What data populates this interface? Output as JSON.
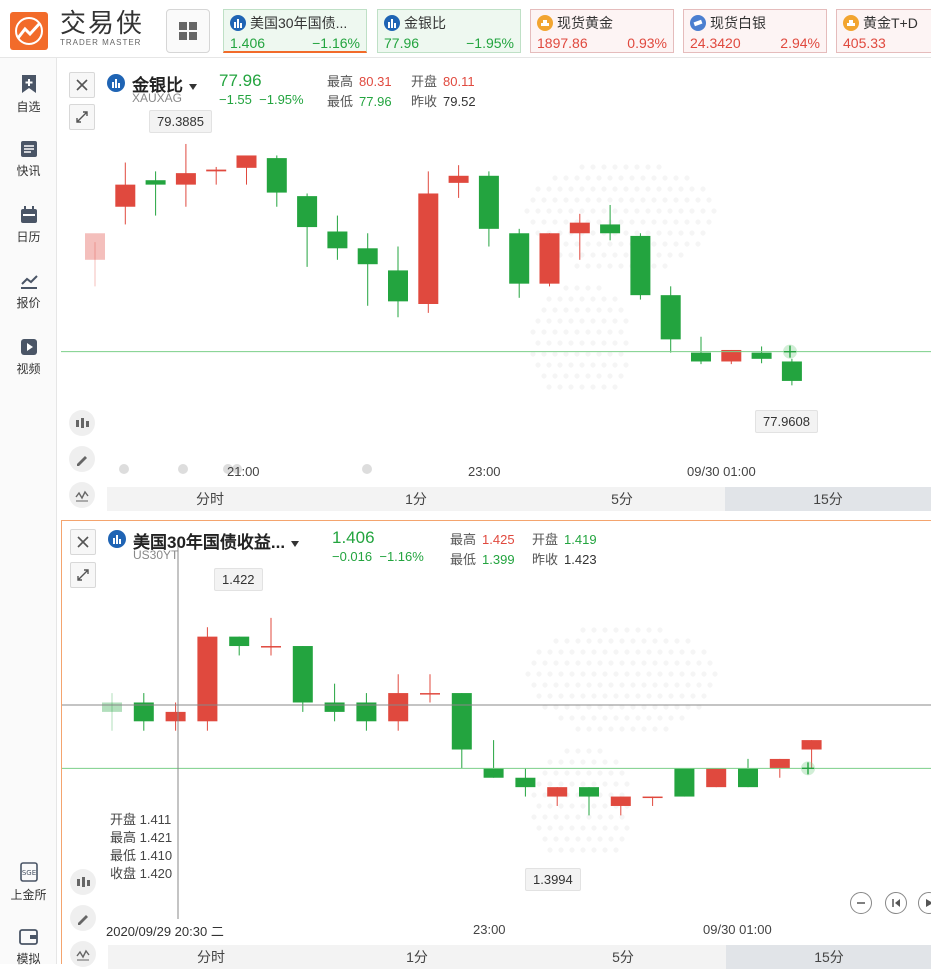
{
  "brand": {
    "name_cn": "交易侠",
    "name_en": "TRADER MASTER",
    "color": "#f26b2a"
  },
  "tickers": [
    {
      "name": "美国30年国债...",
      "price": "1.406",
      "change": "−1.16%",
      "trend": "green",
      "icon": "chart-icon"
    },
    {
      "name": "金银比",
      "price": "77.96",
      "change": "−1.95%",
      "trend": "green",
      "icon": "chart-icon"
    },
    {
      "name": "现货黄金",
      "price": "1897.86",
      "change": "0.93%",
      "trend": "red",
      "icon": "gold-bars-icon"
    },
    {
      "name": "现货白银",
      "price": "24.3420",
      "change": "2.94%",
      "trend": "red",
      "icon": "silver-icon"
    },
    {
      "name": "黄金T+D",
      "price": "405.33",
      "change": "",
      "trend": "red",
      "icon": "gold-bars-icon"
    }
  ],
  "sidebar": {
    "items": [
      {
        "label": "自选",
        "icon": "bookmark-plus-icon"
      },
      {
        "label": "快讯",
        "icon": "news-icon"
      },
      {
        "label": "日历",
        "icon": "calendar-icon"
      },
      {
        "label": "报价",
        "icon": "quote-chart-icon"
      },
      {
        "label": "视频",
        "icon": "video-icon"
      }
    ],
    "bottom": [
      {
        "label": "上金所",
        "icon": "sge-icon"
      },
      {
        "label": "模拟",
        "icon": "wallet-icon"
      }
    ]
  },
  "panel1": {
    "name": "金银比",
    "code": "XAUXAG",
    "price": "77.96",
    "change": "−1.55",
    "change_pct": "−1.95%",
    "stats": {
      "high_k": "最高",
      "high": "80.31",
      "open_k": "开盘",
      "open": "80.11",
      "low_k": "最低",
      "low": "77.96",
      "prev_k": "昨收",
      "prev": "79.52"
    },
    "tip_high": "79.3885",
    "tip_last": "77.9608",
    "times": [
      "21:00",
      "23:00",
      "09/30 01:00"
    ],
    "tabs": [
      "分时",
      "1分",
      "5分",
      "15分"
    ],
    "active_tab": 3
  },
  "panel2": {
    "name": "美国30年国债收益...",
    "code": "US30YT",
    "price": "1.406",
    "change": "−0.016",
    "change_pct": "−1.16%",
    "stats": {
      "high_k": "最高",
      "high": "1.425",
      "open_k": "开盘",
      "open": "1.419",
      "low_k": "最低",
      "low": "1.399",
      "prev_k": "昨收",
      "prev": "1.423"
    },
    "tip_high": "1.422",
    "tip_low": "1.3994",
    "ohlc": {
      "open": "开盘 1.411",
      "high": "最高 1.421",
      "low": "最低 1.410",
      "close": "收盘 1.420"
    },
    "cursor_time": "2020/09/29 20:30 二",
    "times": [
      "23:00",
      "09/30 01:00"
    ],
    "tabs": [
      "分时",
      "1分",
      "5分",
      "15分"
    ],
    "active_tab": 3
  },
  "colors": {
    "up": "#e0493e",
    "down": "#23a43f",
    "accent": "#f26b2a",
    "blue": "#1f64b4"
  },
  "chart_data": [
    {
      "type": "candlestick",
      "series_code": "XAUXAG",
      "x_ticks": [
        "21:00",
        "23:00",
        "09/30 01:00"
      ],
      "candles": [
        {
          "o": 79.0,
          "h": 79.2,
          "l": 78.7,
          "c": 79.3
        },
        {
          "o": 79.6,
          "h": 80.1,
          "l": 79.4,
          "c": 79.85
        },
        {
          "o": 79.9,
          "h": 80.0,
          "l": 79.5,
          "c": 79.85
        },
        {
          "o": 79.85,
          "h": 80.31,
          "l": 79.6,
          "c": 79.98
        },
        {
          "o": 80.0,
          "h": 80.05,
          "l": 79.85,
          "c": 80.02
        },
        {
          "o": 80.04,
          "h": 80.16,
          "l": 79.85,
          "c": 80.18
        },
        {
          "o": 80.15,
          "h": 80.18,
          "l": 79.6,
          "c": 79.76
        },
        {
          "o": 79.72,
          "h": 79.75,
          "l": 78.92,
          "c": 79.37
        },
        {
          "o": 79.32,
          "h": 79.5,
          "l": 79.0,
          "c": 79.13
        },
        {
          "o": 79.13,
          "h": 79.3,
          "l": 78.48,
          "c": 78.95
        },
        {
          "o": 78.88,
          "h": 79.15,
          "l": 78.35,
          "c": 78.53
        },
        {
          "o": 78.5,
          "h": 80.0,
          "l": 78.4,
          "c": 79.75
        },
        {
          "o": 79.87,
          "h": 80.07,
          "l": 79.7,
          "c": 79.95
        },
        {
          "o": 79.95,
          "h": 80.0,
          "l": 79.15,
          "c": 79.35
        },
        {
          "o": 79.3,
          "h": 79.35,
          "l": 78.57,
          "c": 78.73
        },
        {
          "o": 78.73,
          "h": 79.3,
          "l": 78.7,
          "c": 79.3
        },
        {
          "o": 79.3,
          "h": 79.52,
          "l": 79.0,
          "c": 79.42
        },
        {
          "o": 79.4,
          "h": 79.62,
          "l": 79.22,
          "c": 79.3
        },
        {
          "o": 79.27,
          "h": 79.3,
          "l": 78.55,
          "c": 78.6
        },
        {
          "o": 78.6,
          "h": 78.7,
          "l": 77.95,
          "c": 78.1
        },
        {
          "o": 77.95,
          "h": 78.13,
          "l": 77.82,
          "c": 77.85
        },
        {
          "o": 77.85,
          "h": 77.98,
          "l": 77.82,
          "c": 77.98
        },
        {
          "o": 77.95,
          "h": 78.02,
          "l": 77.83,
          "c": 77.88
        },
        {
          "o": 77.85,
          "h": 77.88,
          "l": 77.58,
          "c": 77.63
        }
      ],
      "last_price": 77.9608,
      "ylim": [
        77.55,
        80.4
      ]
    },
    {
      "type": "candlestick",
      "series_code": "US30YT",
      "x_ticks": [
        "23:00",
        "09/30 01:00"
      ],
      "candles": [
        {
          "o": 1.413,
          "h": 1.414,
          "l": 1.41,
          "c": 1.412
        },
        {
          "o": 1.413,
          "h": 1.414,
          "l": 1.41,
          "c": 1.411
        },
        {
          "o": 1.411,
          "h": 1.413,
          "l": 1.41,
          "c": 1.412
        },
        {
          "o": 1.411,
          "h": 1.421,
          "l": 1.41,
          "c": 1.42
        },
        {
          "o": 1.42,
          "h": 1.42,
          "l": 1.418,
          "c": 1.419
        },
        {
          "o": 1.419,
          "h": 1.422,
          "l": 1.418,
          "c": 1.419
        },
        {
          "o": 1.419,
          "h": 1.419,
          "l": 1.412,
          "c": 1.413
        },
        {
          "o": 1.413,
          "h": 1.415,
          "l": 1.411,
          "c": 1.412
        },
        {
          "o": 1.413,
          "h": 1.414,
          "l": 1.41,
          "c": 1.411
        },
        {
          "o": 1.411,
          "h": 1.416,
          "l": 1.41,
          "c": 1.414
        },
        {
          "o": 1.414,
          "h": 1.416,
          "l": 1.413,
          "c": 1.414
        },
        {
          "o": 1.414,
          "h": 1.414,
          "l": 1.406,
          "c": 1.408
        },
        {
          "o": 1.406,
          "h": 1.409,
          "l": 1.405,
          "c": 1.405
        },
        {
          "o": 1.405,
          "h": 1.406,
          "l": 1.403,
          "c": 1.404
        },
        {
          "o": 1.403,
          "h": 1.404,
          "l": 1.402,
          "c": 1.404
        },
        {
          "o": 1.404,
          "h": 1.404,
          "l": 1.401,
          "c": 1.403
        },
        {
          "o": 1.402,
          "h": 1.403,
          "l": 1.401,
          "c": 1.403
        },
        {
          "o": 1.403,
          "h": 1.403,
          "l": 1.402,
          "c": 1.403
        },
        {
          "o": 1.406,
          "h": 1.406,
          "l": 1.403,
          "c": 1.403
        },
        {
          "o": 1.404,
          "h": 1.406,
          "l": 1.404,
          "c": 1.406
        },
        {
          "o": 1.406,
          "h": 1.407,
          "l": 1.404,
          "c": 1.404
        },
        {
          "o": 1.406,
          "h": 1.407,
          "l": 1.405,
          "c": 1.407
        },
        {
          "o": 1.408,
          "h": 1.409,
          "l": 1.406,
          "c": 1.409
        }
      ],
      "last_price": 1.406,
      "ylim": [
        1.397,
        1.424
      ]
    }
  ]
}
